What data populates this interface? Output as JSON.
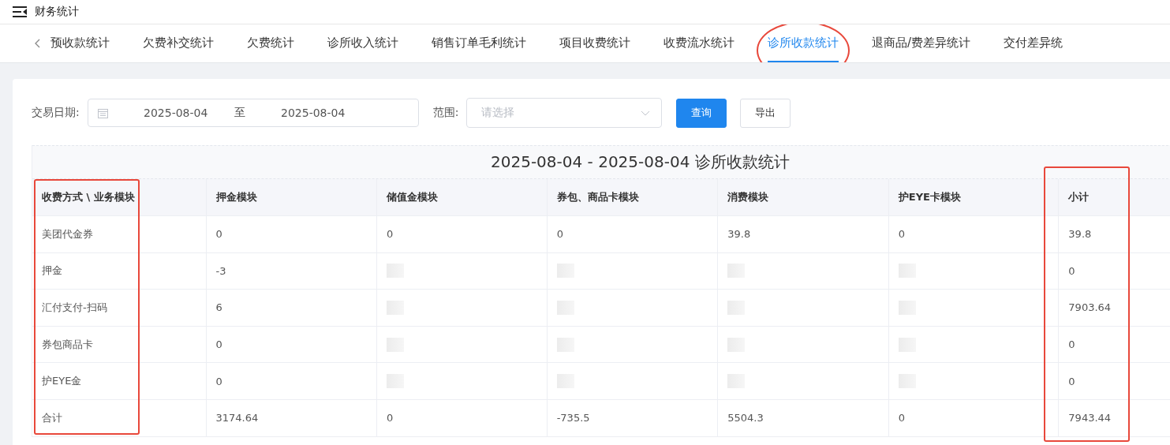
{
  "header": {
    "title": "财务统计"
  },
  "tabs": [
    {
      "label": "预收款统计",
      "selected": false,
      "circled": false
    },
    {
      "label": "欠费补交统计",
      "selected": false,
      "circled": false
    },
    {
      "label": "欠费统计",
      "selected": false,
      "circled": false
    },
    {
      "label": "诊所收入统计",
      "selected": false,
      "circled": false
    },
    {
      "label": "销售订单毛利统计",
      "selected": false,
      "circled": false
    },
    {
      "label": "项目收费统计",
      "selected": false,
      "circled": false
    },
    {
      "label": "收费流水统计",
      "selected": false,
      "circled": false
    },
    {
      "label": "诊所收款统计",
      "selected": true,
      "circled": true
    },
    {
      "label": "退商品/费差异统计",
      "selected": false,
      "circled": false
    },
    {
      "label": "交付差异统",
      "selected": false,
      "circled": false
    }
  ],
  "filters": {
    "date_label": "交易日期:",
    "date_from": "2025-08-04",
    "date_sep": "至",
    "date_to": "2025-08-04",
    "range_label": "范围:",
    "range_placeholder": "请选择",
    "query_button": "查询",
    "export_button": "导出"
  },
  "table": {
    "title": "2025-08-04 - 2025-08-04 诊所收款统计",
    "columns": [
      {
        "label": "收费方式 \\ 业务模块",
        "boxed": true
      },
      {
        "label": "押金模块",
        "boxed": false
      },
      {
        "label": "储值金模块",
        "boxed": false
      },
      {
        "label": "券包、商品卡模块",
        "boxed": false
      },
      {
        "label": "消费模块",
        "boxed": false
      },
      {
        "label": "护EYE卡模块",
        "boxed": false
      },
      {
        "label": "小计",
        "boxed": true
      }
    ],
    "rows": [
      [
        "美团代金券",
        "0",
        "0",
        "0",
        "39.8",
        "0",
        "39.8"
      ],
      [
        "押金",
        "-3",
        null,
        null,
        null,
        null,
        "0"
      ],
      [
        "汇付支付-扫码",
        "6",
        null,
        null,
        null,
        null,
        "7903.64"
      ],
      [
        "券包商品卡",
        "0",
        null,
        null,
        null,
        null,
        "0"
      ],
      [
        "护EYE金",
        "0",
        null,
        null,
        null,
        null,
        "0"
      ],
      [
        "合计",
        "3174.64",
        "0",
        "-735.5",
        "5504.3",
        "0",
        "7943.44"
      ]
    ]
  }
}
